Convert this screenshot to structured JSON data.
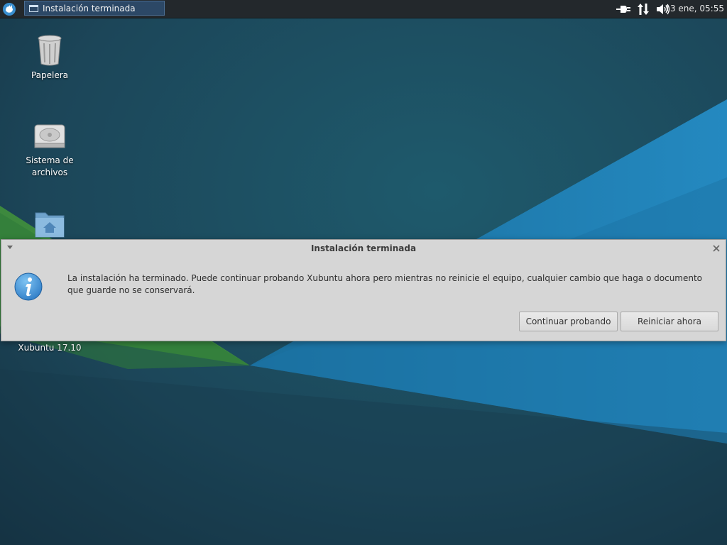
{
  "panel": {
    "task_title": "Instalación terminada",
    "clock": "13 ene, 05:55",
    "tray_icons": [
      "power-plug-icon",
      "network-arrows-icon",
      "volume-icon"
    ]
  },
  "desktop": {
    "icons": [
      {
        "label": "Papelera",
        "icon": "trash-icon"
      },
      {
        "label": "Sistema de archivos",
        "icon": "hard-drive-icon"
      },
      {
        "label": "",
        "icon": "home-folder-icon"
      },
      {
        "label": "Xubuntu 17.10",
        "icon": "disc-icon"
      }
    ]
  },
  "dialog": {
    "title": "Instalación terminada",
    "message": "La instalación ha terminado. Puede continuar probando Xubuntu ahora pero mientras no reinicie el equipo, cualquier cambio que haga o documento que guarde no se conservará.",
    "buttons": {
      "continue": "Continuar probando",
      "restart": "Reiniciar ahora"
    },
    "icon": "info-icon"
  },
  "colors": {
    "wallpaper_dark": "#1f4b5e",
    "wallpaper_blue": "#1d7fb0",
    "wallpaper_green": "#4f9a3b",
    "panel": "#23282c",
    "dialog_bg": "#d6d6d6"
  }
}
